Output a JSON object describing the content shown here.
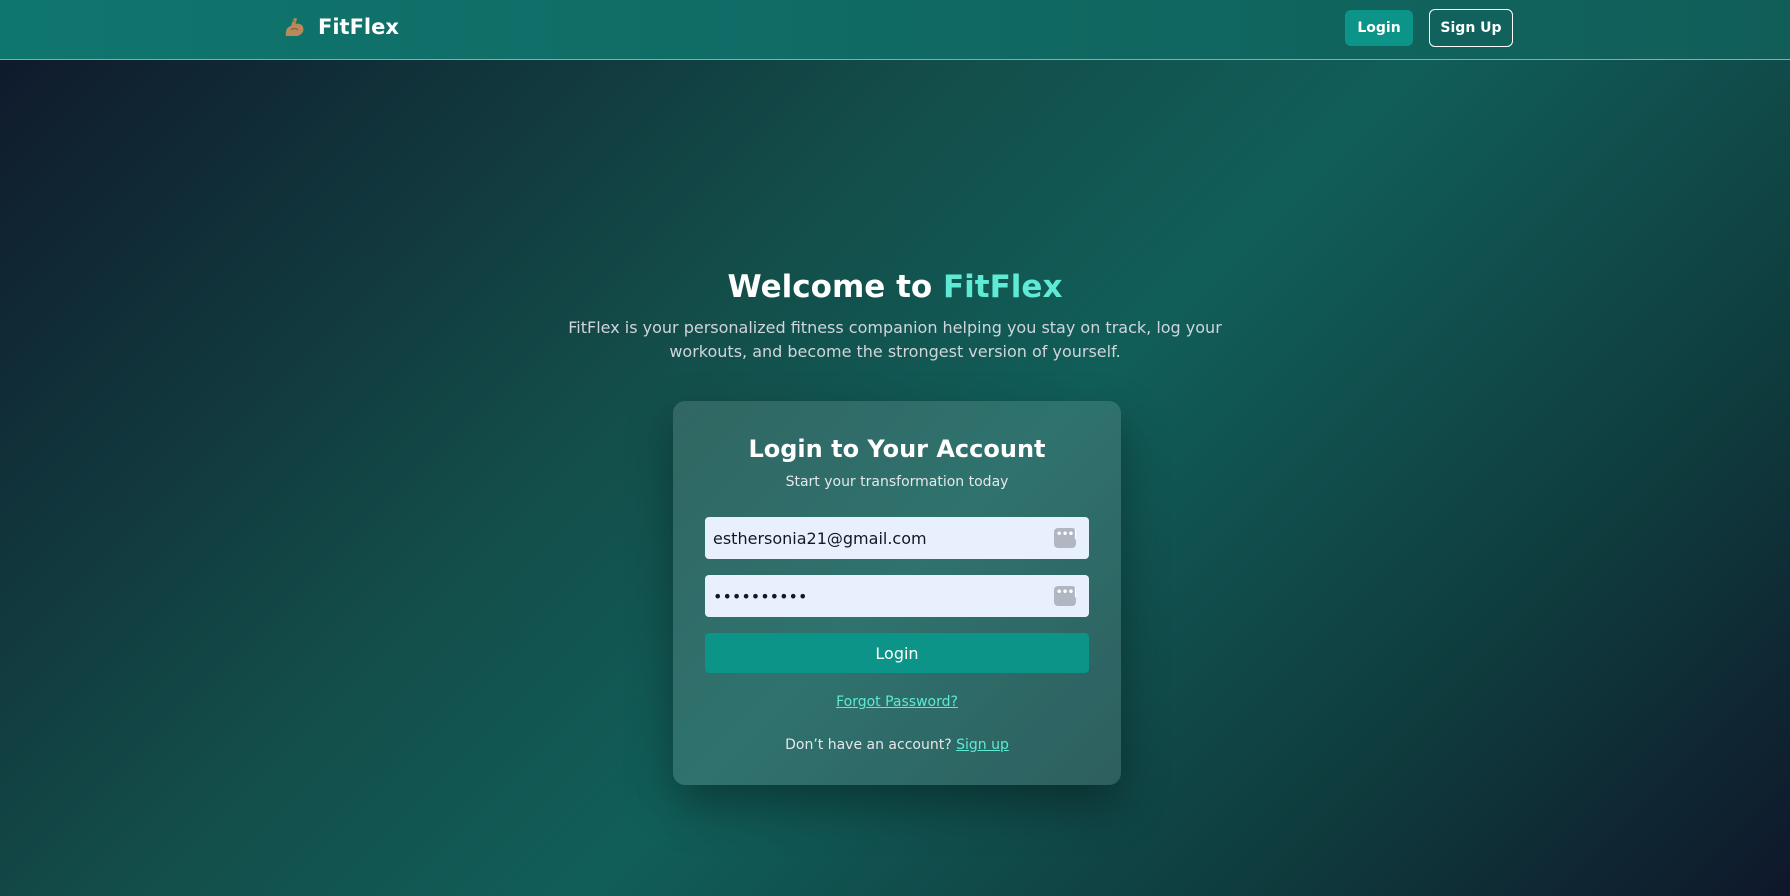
{
  "navbar": {
    "brand_icon": "flexed-biceps-icon",
    "brand_name": "FitFlex",
    "login_label": "Login",
    "signup_label": "Sign Up"
  },
  "hero": {
    "title_prefix": "Welcome to ",
    "title_accent": "FitFlex",
    "description": "FitFlex is your personalized fitness companion helping you stay on track, log your workouts, and become the strongest version of yourself."
  },
  "login_card": {
    "title": "Login to Your Account",
    "subtitle": "Start your transformation today",
    "email_value": "esthersonia21@gmail.com",
    "password_value": "••••••••••",
    "submit_label": "Login",
    "forgot_label": "Forgot Password?",
    "no_account_text": "Don’t have an account?",
    "signup_link": "Sign up"
  },
  "colors": {
    "accent": "#5eead4",
    "primary_button": "#0d9488",
    "navbar": "#0f766e"
  }
}
